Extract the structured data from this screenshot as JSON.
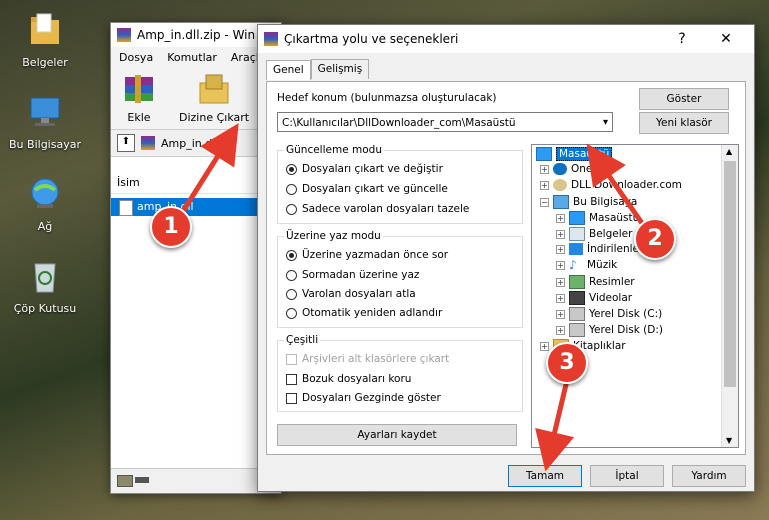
{
  "desktop": {
    "icons": [
      {
        "label": "Belgeler"
      },
      {
        "label": "Bu Bilgisayar"
      },
      {
        "label": "Ağ"
      },
      {
        "label": "Çöp Kutusu"
      }
    ]
  },
  "winrar": {
    "title": "Amp_in.dll.zip - Win",
    "menu": [
      "Dosya",
      "Komutlar",
      "Araçla"
    ],
    "tools": {
      "add": "Ekle",
      "extract": "Dizine Çıkart"
    },
    "path": "Amp_in.dll.",
    "column_name": "İsim",
    "file": "amp_in.dll"
  },
  "dialog": {
    "title": "Çıkartma yolu ve seçenekleri",
    "help_glyph": "?",
    "close_glyph": "✕",
    "tabs": [
      "Genel",
      "Gelişmiş"
    ],
    "dest_label": "Hedef konum (bulunmazsa oluşturulacak)",
    "dest_value": "C:\\Kullanıcılar\\DllDownloader_com\\Masaüstü",
    "show_button": "Göster",
    "new_folder_button": "Yeni klasör",
    "update_group": {
      "title": "Güncelleme modu",
      "options": [
        "Dosyaları çıkart ve değiştir",
        "Dosyaları çıkart ve güncelle",
        "Sadece varolan dosyaları tazele"
      ]
    },
    "overwrite_group": {
      "title": "Üzerine yaz modu",
      "options": [
        "Üzerine yazmadan önce sor",
        "Sormadan üzerine yaz",
        "Varolan dosyaları atla",
        "Otomatik yeniden adlandır"
      ]
    },
    "misc_group": {
      "title": "Çeşitli",
      "options": [
        "Arşivleri alt klasörlere çıkart",
        "Bozuk dosyaları koru",
        "Dosyaları Gezginde göster"
      ]
    },
    "save_settings": "Ayarları kaydet",
    "tree": [
      "Masaüstü",
      "OneDri",
      "DLL Downloader.com",
      "Bu Bilgisaya",
      "Masaüstü",
      "Belgeler",
      "İndirilenler",
      "Müzik",
      "Resimler",
      "Videolar",
      "Yerel Disk (C:)",
      "Yerel Disk (D:)",
      "Kitaplıklar"
    ],
    "ok": "Tamam",
    "cancel": "İptal",
    "help": "Yardım"
  },
  "callouts": [
    "1",
    "2",
    "3"
  ],
  "colors": {
    "callout": "#e53b2c",
    "arrow": "#e53b2c",
    "selection": "#0078d7"
  }
}
